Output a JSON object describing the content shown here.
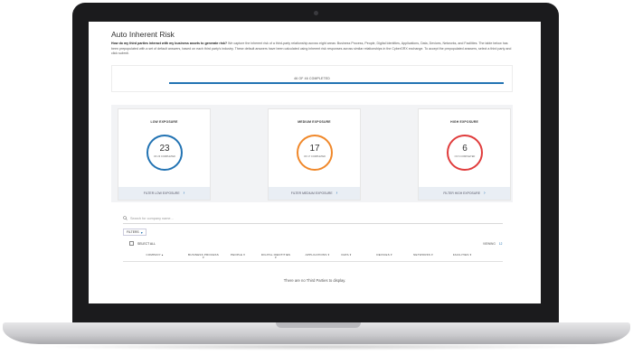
{
  "page": {
    "title": "Auto Inherent Risk",
    "intro_bold": "How do my third parties interact with my business assets to generate risk?",
    "intro_rest": " We capture the inherent risk of a third-party relationship across eight areas: Business Process, People, Digital Identities, Applications, Data, Devices, Networks, and Facilities. The table below has been prepopulated with a set of default answers, based on each third party's industry. These default answers have been calculated using inherent risk responses across similar relationships in the CyberGRX exchange. To accept the prepopulated answers, select a third party and click submit."
  },
  "progress": {
    "label": "46 OF 46 COMPLETED",
    "fraction": 1.0,
    "color": "#2273b3"
  },
  "exposures": [
    {
      "title": "LOW EXPOSURE",
      "count": "23",
      "sub": "OF 23 COMPLETED",
      "filter": "FILTER LOW EXPOSURE",
      "color": "#2273b3"
    },
    {
      "title": "MEDIUM EXPOSURE",
      "count": "17",
      "sub": "OF 17 COMPLETED",
      "filter": "FILTER MEDIUM EXPOSURE",
      "color": "#f0882a"
    },
    {
      "title": "HIGH EXPOSURE",
      "count": "6",
      "sub": "OF 6 COMPLETED",
      "filter": "FILTER HIGH EXPOSURE",
      "color": "#e03c3c"
    }
  ],
  "search": {
    "placeholder": "Search for company name...",
    "icon": "search-icon"
  },
  "filters_label": "FILTERS",
  "select_all_label": "SELECT ALL",
  "viewing": {
    "label": "VIEWING",
    "count": "12"
  },
  "columns": [
    "COMPANY",
    "BUSINESS PROCESS",
    "PEOPLE",
    "DIGITAL IDENTITIES",
    "APPLICATIONS",
    "DATA",
    "DEVICES",
    "NETWORKS",
    "FACILITIES"
  ],
  "empty_message": "There are no Third Parties to display."
}
